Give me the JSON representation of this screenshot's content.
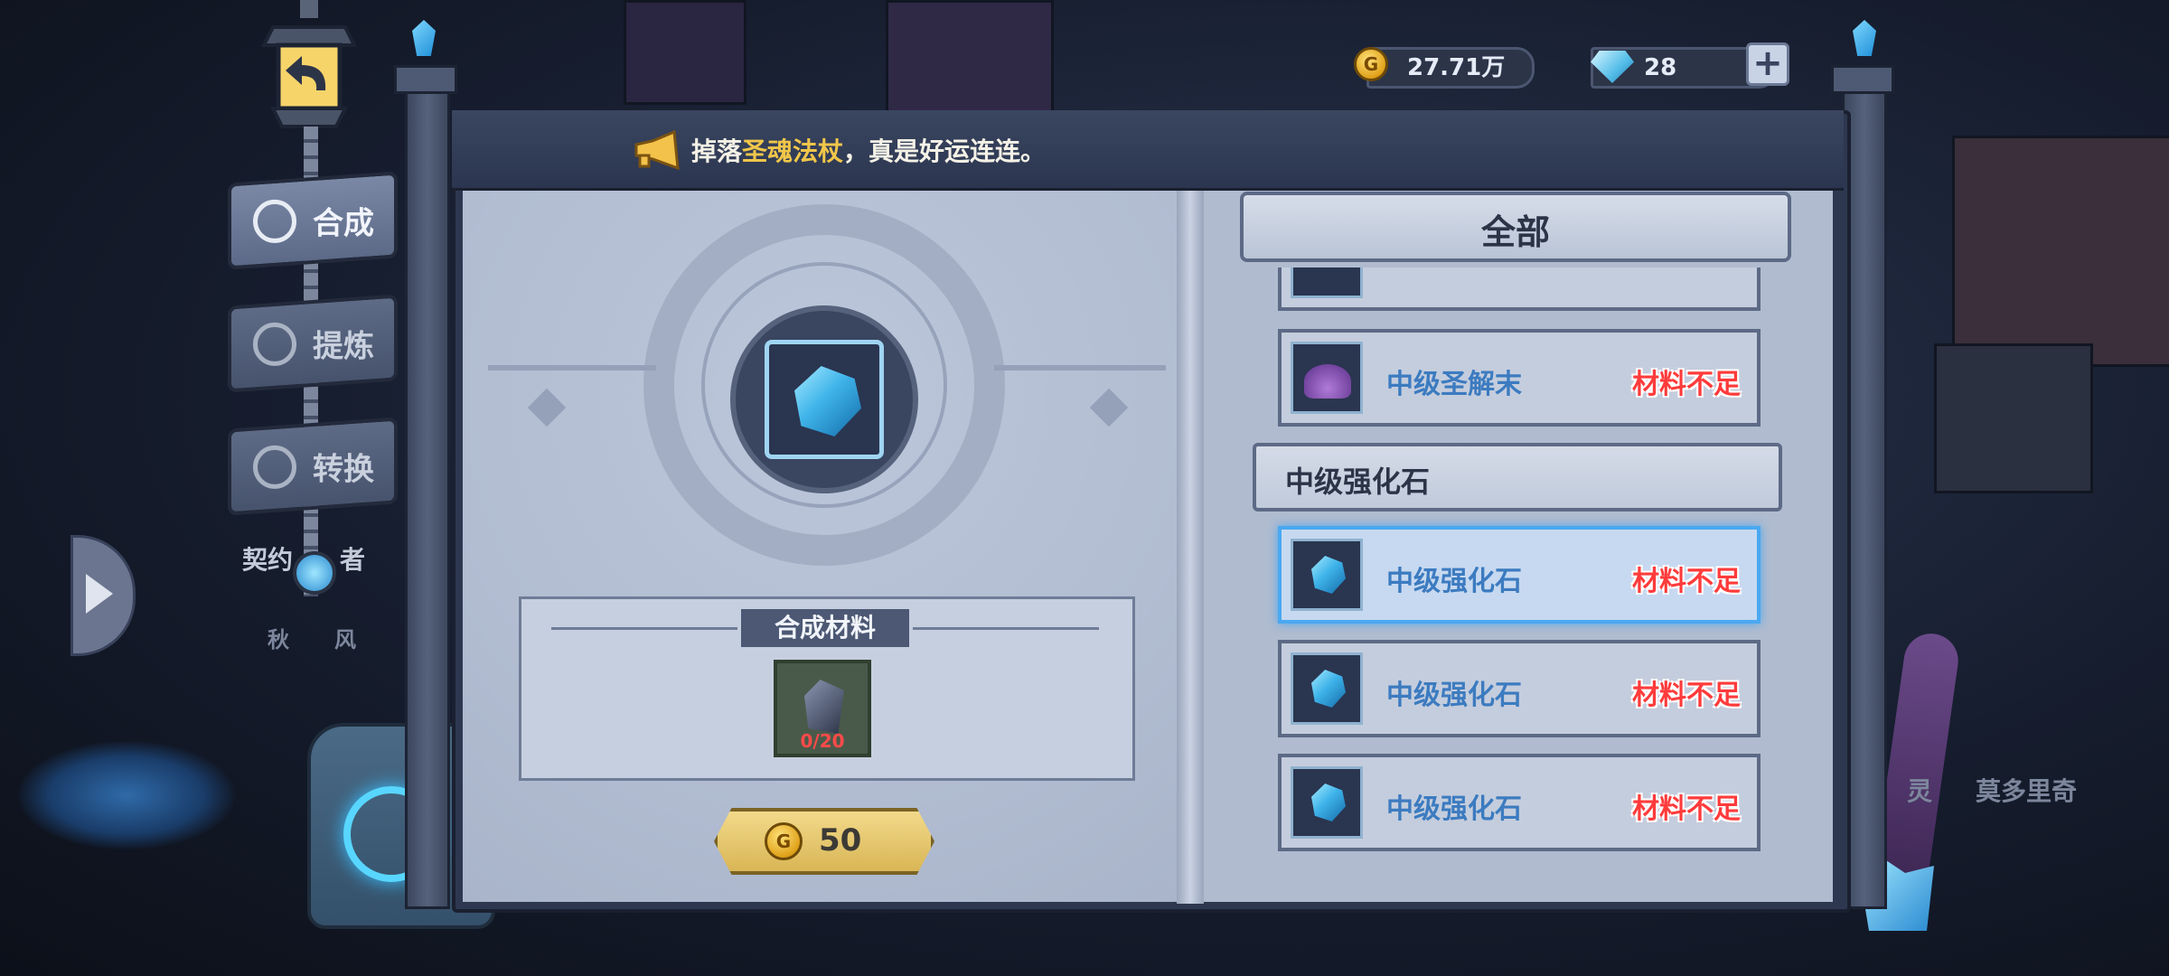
{
  "resources": {
    "gold": "27.71万",
    "gems": "28",
    "gold_icon_letter": "G",
    "add_icon": "+"
  },
  "banner": {
    "prefix": "掉落",
    "item": "圣魂法杖",
    "suffix": "，真是好运连连。"
  },
  "nav": {
    "items": [
      {
        "label": "合成",
        "icon": "synthesis-icon",
        "active": true
      },
      {
        "label": "提炼",
        "icon": "refine-icon",
        "active": false
      },
      {
        "label": "转换",
        "icon": "convert-icon",
        "active": false
      }
    ],
    "background_label": "契约",
    "background_label_2": "者",
    "background_name": "秋",
    "background_name_2": "风"
  },
  "craft": {
    "materials_title": "合成材料",
    "material_count": "0/20",
    "cost": "50",
    "cost_icon_letter": "G"
  },
  "list": {
    "filter_label": "全部",
    "items_above": [
      {
        "name": "中级圣解末",
        "status": "材料不足",
        "icon": "purple-powder-icon"
      }
    ],
    "category": "中级强化石",
    "items": [
      {
        "name": "中级强化石",
        "status": "材料不足",
        "selected": true
      },
      {
        "name": "中级强化石",
        "status": "材料不足",
        "selected": false
      },
      {
        "name": "中级强化石",
        "status": "材料不足",
        "selected": false
      }
    ]
  },
  "background_text": {
    "right_name": "莫多里奇",
    "right_prefix": "灵"
  },
  "colors": {
    "warning": "#ff3b3b",
    "item_name": "#3c7bc0",
    "highlight": "#f0c64a",
    "selected_border": "#4aa8f0"
  }
}
